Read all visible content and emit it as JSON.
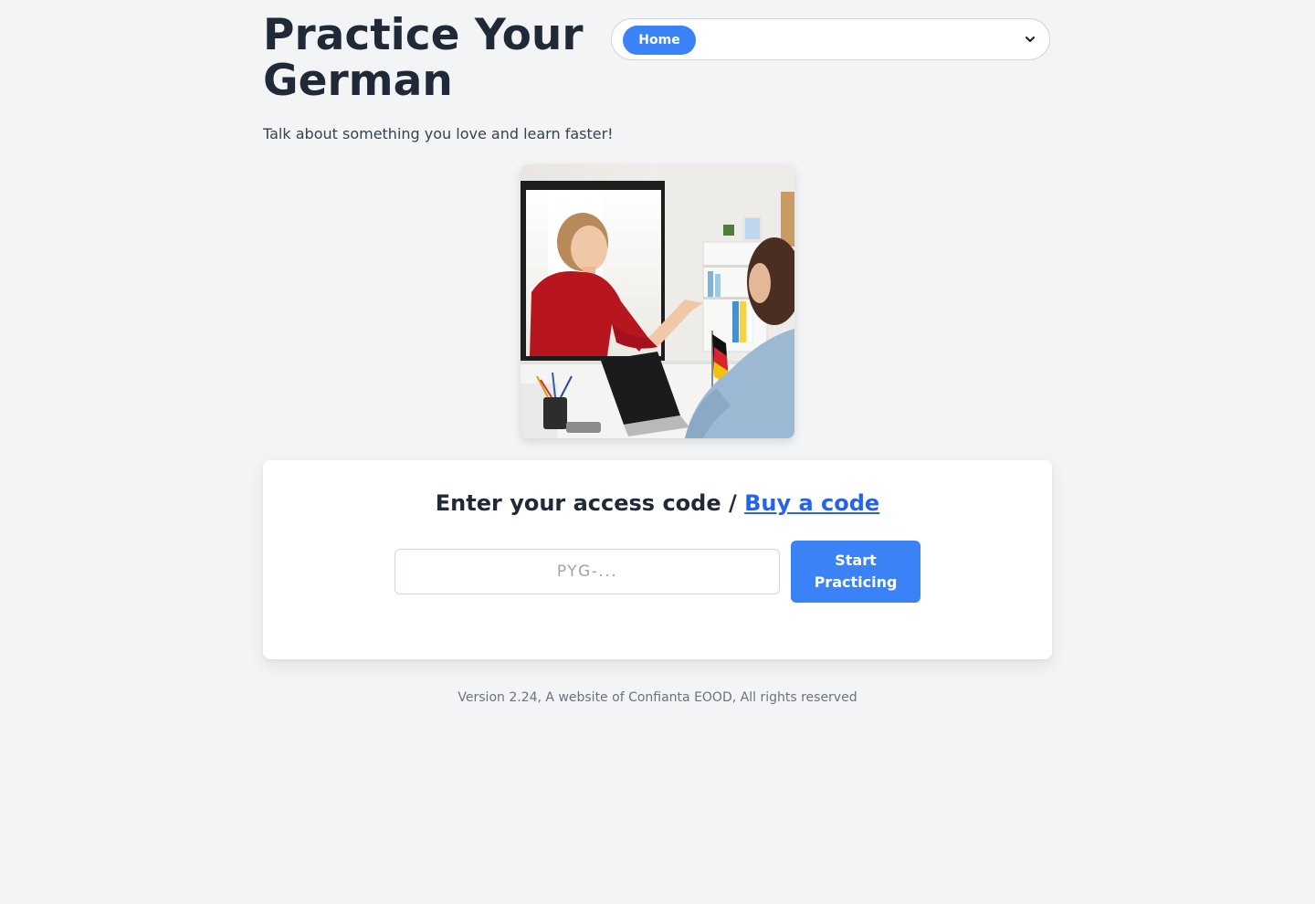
{
  "header": {
    "title": "Practice Your German",
    "nav": {
      "selected": "Home"
    }
  },
  "tagline": "Talk about something you love and learn faster!",
  "access": {
    "heading": "Enter your access code /",
    "buy_link": "Buy a code",
    "input_placeholder": "PYG-...",
    "input_value": "",
    "start_button": "Start Practicing"
  },
  "footer": {
    "text": "Version 2.24, A website of Confianta EOOD, All rights reserved"
  },
  "colors": {
    "background": "#f2f4f6",
    "accent": "#3b82f6",
    "link": "#2563eb",
    "heading": "#1f2937"
  }
}
